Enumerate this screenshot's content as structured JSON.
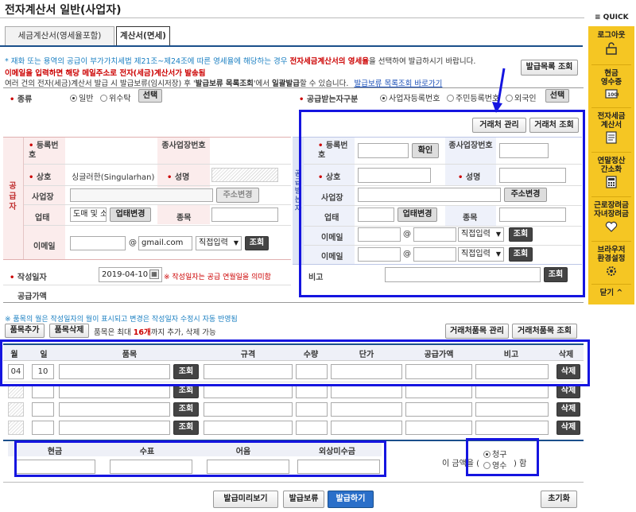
{
  "title": "전자계산서 일반(사업자)",
  "tabs": [
    {
      "label": "세금계산서(영세율포함)"
    },
    {
      "label": "계산서(면세)"
    }
  ],
  "notice": {
    "line1a": "* 재화 또는 용역의 공급이 부가가치세법 제21조~제24조에 따른 영세율에 해당하는 경우 ",
    "line1b": "전자세금계산서의 영세율",
    "line1c": "을 선택하여 발급하시기 바랍니다.",
    "line2": "이메일을 입력하면 해당 메일주소로 전자(세금)계산서가 발송됨",
    "line3a": "여러 건의 전자(세금)계산서 발급 시 발급보류(임시저장) 후 '",
    "line3b": "발급보류 목록조회",
    "line3c": "'에서 ",
    "line3d": "일괄발급",
    "line3e": "할 수 있습니다.",
    "line3link": "발급보류 목록조회 바로가기",
    "list_button": "발급목록 조회"
  },
  "kind": {
    "label": "종류",
    "options": [
      "일반",
      "위수탁"
    ],
    "selected": "일반",
    "select_button": "선택"
  },
  "receiver_type": {
    "label": "공급받는자구분",
    "options": [
      "사업자등록번호",
      "주민등록번호",
      "외국인"
    ],
    "selected": "사업자등록번호",
    "select_button": "선택"
  },
  "partner_buttons": {
    "manage": "거래처 관리",
    "search": "거래처 조회"
  },
  "supplier": {
    "side_label": "공급자",
    "reg_no_label": "등록번호",
    "sub_biz_label": "종사업장번호",
    "name_label": "상호",
    "name_value": "싱글러한(Singularhan)",
    "rep_label": "성명",
    "address_label": "사업장",
    "address_button": "주소변경",
    "biz_type_label": "업태",
    "biz_type_value": "도매 및 소",
    "biz_type_button": "업태변경",
    "item_label": "종목",
    "email_label": "이메일",
    "email_at": "@",
    "email_domain": "gmail.com",
    "email_select": "직접입력",
    "email_button": "조회"
  },
  "buyer": {
    "side_label": "공급받는자",
    "reg_no_label": "등록번호",
    "confirm_button": "확인",
    "sub_biz_label": "종사업장번호",
    "name_label": "상호",
    "rep_label": "성명",
    "address_label": "사업장",
    "address_button": "주소변경",
    "biz_type_label": "업태",
    "biz_type_button": "업태변경",
    "item_label": "종목",
    "email_label": "이메일",
    "email_at": "@",
    "email_select": "직접입력",
    "email_button": "조회",
    "email2_label": "이메일",
    "email2_at": "@",
    "email2_select": "직접입력",
    "email2_button": "조회",
    "memo_label": "비고",
    "memo_button": "조회"
  },
  "write_date": {
    "label": "작성일자",
    "value": "2019-04-10",
    "note": "※ 작성일자는 공급 연월일을 의미함"
  },
  "supply_amount_label": "공급가액",
  "items_note": "※ 품목의 월은 작성일자의 월이 표시되고 변경은 작성일자 수정시 자동 반영됨",
  "items_toolbar": {
    "add": "품목추가",
    "delete": "품목삭제",
    "limit_a": "품목은 최대 ",
    "limit_b": "16개",
    "limit_c": "까지 추가, 삭제 가능",
    "manage": "거래처품목 관리",
    "search": "거래처품목 조회"
  },
  "items_header": [
    "월",
    "일",
    "품목",
    "규격",
    "수량",
    "단가",
    "공급가액",
    "비고",
    "삭제"
  ],
  "items_rows": [
    {
      "month": "04",
      "day": "10",
      "search": "조회",
      "delete": "삭제"
    },
    {
      "month": "",
      "day": "",
      "search": "조회",
      "delete": "삭제"
    },
    {
      "month": "",
      "day": "",
      "search": "조회",
      "delete": "삭제"
    },
    {
      "month": "",
      "day": "",
      "search": "조회",
      "delete": "삭제"
    }
  ],
  "payment_header": [
    "현금",
    "수표",
    "어음",
    "외상미수금"
  ],
  "amount_type": {
    "prefix": "이 금액을 (",
    "options": [
      "청구",
      "영수"
    ],
    "selected": "청구",
    "suffix": ") 함"
  },
  "footer_buttons": {
    "preview": "발급미리보기",
    "hold": "발급보류",
    "issue": "발급하기",
    "reset": "초기화"
  },
  "sidebar": {
    "quick_label": "≡ QUICK",
    "items": [
      {
        "label": "로그아웃"
      },
      {
        "label": "현금\n영수증"
      },
      {
        "label": "전자세금\n계산서"
      },
      {
        "label": "연말정산\n간소화"
      },
      {
        "label": "근로장려금\n자녀장려금"
      },
      {
        "label": "브라우저\n환경설정"
      }
    ],
    "close_label": "닫기 ^"
  },
  "colors": {
    "accent": "#1a4f8b",
    "sidebar": "#f5c623",
    "highlight": "#1515e0",
    "required": "#c00000",
    "issue_button": "#2a6fc9"
  }
}
